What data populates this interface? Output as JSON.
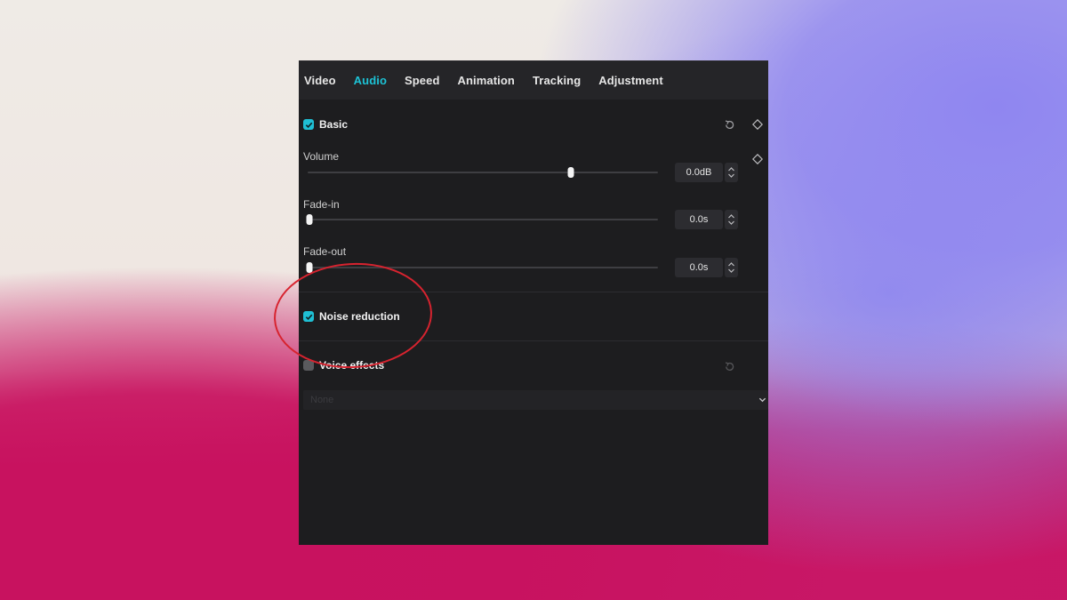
{
  "tabs": [
    {
      "label": "Video",
      "active": false
    },
    {
      "label": "Audio",
      "active": true
    },
    {
      "label": "Speed",
      "active": false
    },
    {
      "label": "Animation",
      "active": false
    },
    {
      "label": "Tracking",
      "active": false
    },
    {
      "label": "Adjustment",
      "active": false
    }
  ],
  "basic": {
    "title": "Basic",
    "checked": true,
    "volume": {
      "label": "Volume",
      "value": "0.0dB",
      "slider_fraction": 0.75
    },
    "fade_in": {
      "label": "Fade-in",
      "value": "0.0s",
      "slider_fraction": 0.0
    },
    "fade_out": {
      "label": "Fade-out",
      "value": "0.0s",
      "slider_fraction": 0.0
    }
  },
  "noise_reduction": {
    "title": "Noise reduction",
    "checked": true
  },
  "voice_effects": {
    "title": "Voice effects",
    "checked": false,
    "dropdown_value": "None"
  },
  "colors": {
    "accent": "#1dc3d6",
    "annotation": "#d7232f"
  }
}
